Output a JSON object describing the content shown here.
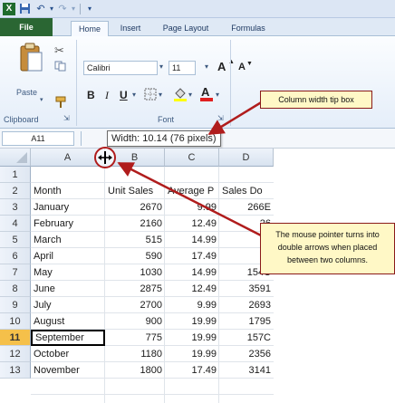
{
  "quick_access": {
    "app_icon": "excel-icon",
    "save_icon": "save-icon",
    "undo_icon": "undo-icon",
    "redo_icon": "redo-icon"
  },
  "tabs": {
    "file": "File",
    "home": "Home",
    "insert": "Insert",
    "page_layout": "Page Layout",
    "formulas": "Formulas"
  },
  "ribbon": {
    "paste_label": "Paste",
    "clipboard_label": "Clipboard",
    "font_name": "Calibri",
    "font_size": "11",
    "grow_font": "A",
    "shrink_font": "A",
    "bold": "B",
    "italic": "I",
    "underline": "U",
    "font_label": "Font"
  },
  "formula_bar": {
    "name_box": "A11",
    "tooltip": "Width: 10.14 (76 pixels)"
  },
  "columns": [
    "A",
    "B",
    "C",
    "D"
  ],
  "rows": [
    {
      "num": "1",
      "a": "",
      "b": "",
      "c": "",
      "d": ""
    },
    {
      "num": "2",
      "a": "Month",
      "b": "Unit Sales",
      "c": "Average P",
      "d": "Sales Do"
    },
    {
      "num": "3",
      "a": "January",
      "b": "2670",
      "c": "9.99",
      "d": "266E"
    },
    {
      "num": "4",
      "a": "February",
      "b": "2160",
      "c": "12.49",
      "d": "26"
    },
    {
      "num": "5",
      "a": "March",
      "b": "515",
      "c": "14.99",
      "d": "7"
    },
    {
      "num": "6",
      "a": "April",
      "b": "590",
      "c": "17.49",
      "d": "10"
    },
    {
      "num": "7",
      "a": "May",
      "b": "1030",
      "c": "14.99",
      "d": "154C"
    },
    {
      "num": "8",
      "a": "June",
      "b": "2875",
      "c": "12.49",
      "d": "3591"
    },
    {
      "num": "9",
      "a": "July",
      "b": "2700",
      "c": "9.99",
      "d": "2693"
    },
    {
      "num": "10",
      "a": "August",
      "b": "900",
      "c": "19.99",
      "d": "1795"
    },
    {
      "num": "11",
      "a": "September",
      "b": "775",
      "c": "19.99",
      "d": "157C"
    },
    {
      "num": "12",
      "a": "October",
      "b": "1180",
      "c": "19.99",
      "d": "2356"
    },
    {
      "num": "13",
      "a": "November",
      "b": "1800",
      "c": "17.49",
      "d": "3141"
    }
  ],
  "annotations": {
    "tip_box": "Column width tip box",
    "pointer_note": "The mouse pointer turns into double arrows when placed between two columns."
  },
  "colors": {
    "file_tab": "#2a6633",
    "callout_border": "#8a1a1a",
    "callout_fill": "#fff8c6",
    "active_row_header": "#f5c04a"
  }
}
